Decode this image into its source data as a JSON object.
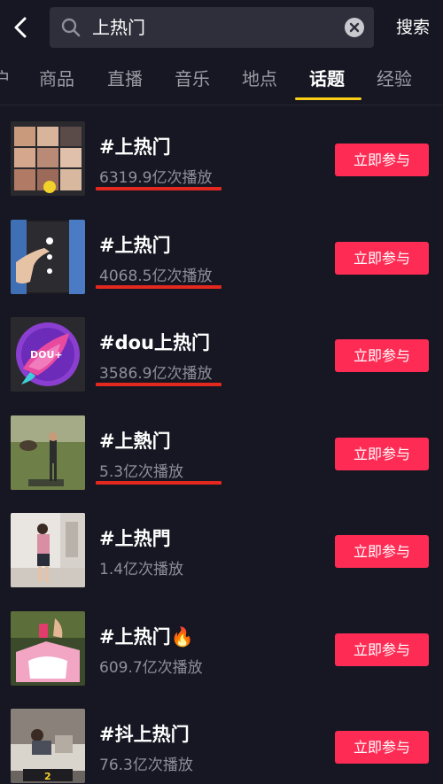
{
  "search": {
    "query": "上热门",
    "submit_label": "搜索"
  },
  "tabs": [
    {
      "label": "户",
      "active": false
    },
    {
      "label": "商品",
      "active": false
    },
    {
      "label": "直播",
      "active": false
    },
    {
      "label": "音乐",
      "active": false
    },
    {
      "label": "地点",
      "active": false
    },
    {
      "label": "话题",
      "active": true
    },
    {
      "label": "经验",
      "active": false
    }
  ],
  "colors": {
    "background": "#161722",
    "accent_underline": "#face15",
    "join_button": "#fe2c55",
    "highlight_line": "#e2281f"
  },
  "results": [
    {
      "title": "#上热门",
      "views": "6319.9亿次播放",
      "join_label": "立即参与",
      "highlighted": true,
      "thumb_icon": "collage-thumbnail"
    },
    {
      "title": "#上热门",
      "views": "4068.5亿次播放",
      "join_label": "立即参与",
      "highlighted": true,
      "thumb_icon": "phone-hand-thumbnail"
    },
    {
      "title": "#dou上热门",
      "views": "3586.9亿次播放",
      "join_label": "立即参与",
      "highlighted": true,
      "thumb_icon": "dou-plus-logo-thumbnail"
    },
    {
      "title": "#上熱门",
      "views": "5.3亿次播放",
      "join_label": "立即参与",
      "highlighted": true,
      "thumb_icon": "outdoor-video-thumbnail"
    },
    {
      "title": "#上热門",
      "views": "1.4亿次播放",
      "join_label": "立即参与",
      "highlighted": false,
      "thumb_icon": "indoor-video-thumbnail"
    },
    {
      "title": "#上热门🔥",
      "views": "609.7亿次播放",
      "join_label": "立即参与",
      "highlighted": false,
      "thumb_icon": "gift-box-thumbnail"
    },
    {
      "title": "#抖上热门",
      "views": "76.3亿次播放",
      "join_label": "立即参与",
      "highlighted": false,
      "thumb_icon": "bedroom-video-thumbnail"
    }
  ]
}
